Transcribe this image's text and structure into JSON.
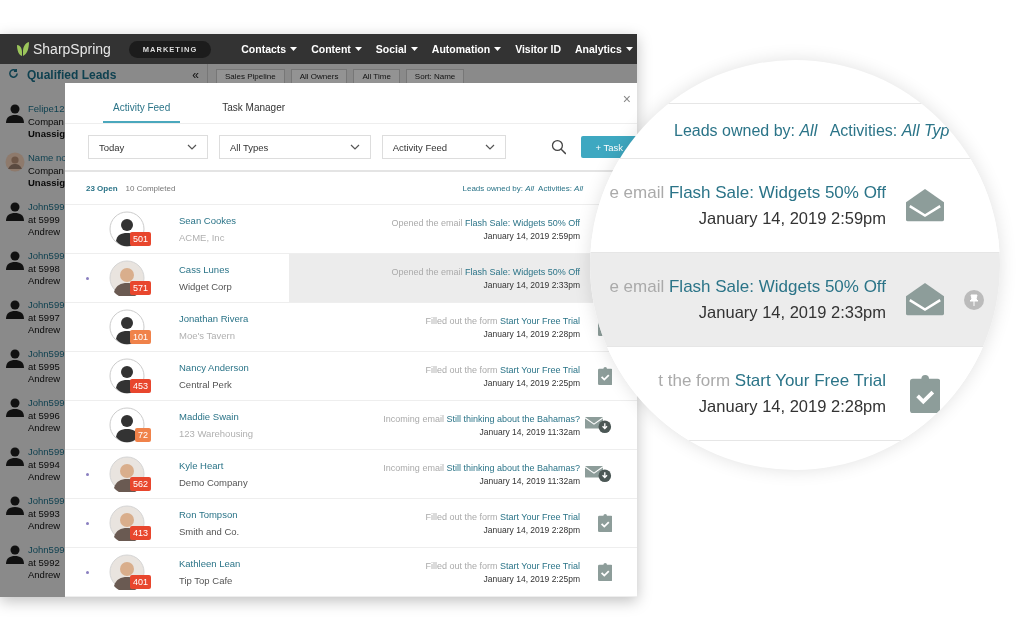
{
  "navbar": {
    "brand": "SharpSpring",
    "product": "MARKETING",
    "items": [
      {
        "label": "Contacts",
        "has_menu": true
      },
      {
        "label": "Content",
        "has_menu": true
      },
      {
        "label": "Social",
        "has_menu": true
      },
      {
        "label": "Automation",
        "has_menu": true
      },
      {
        "label": "Visitor ID",
        "has_menu": false
      },
      {
        "label": "Analytics",
        "has_menu": true
      }
    ]
  },
  "background": {
    "panel_title": "Qualified Leads",
    "collapse": "«",
    "filters": [
      "Sales Pipeline",
      "All Owners",
      "All Time",
      "Sort: Name"
    ],
    "leads": [
      {
        "name": "Felipe12",
        "line2": "Compan",
        "line3": "Unassig",
        "avatar": {
          "kind": "silhouette"
        }
      },
      {
        "name": "Name no",
        "line2": "Compan",
        "line3": "Unassig"
      },
      {
        "name": "John599",
        "line2": "at 5999",
        "line3": "Andrew",
        "avatar": {
          "kind": "silhouette"
        }
      },
      {
        "name": "John599",
        "line2": "at 5998",
        "line3": "Andrew",
        "avatar": {
          "kind": "silhouette"
        }
      },
      {
        "name": "John599",
        "line2": "at 5997",
        "line3": "Andrew",
        "avatar": {
          "kind": "silhouette"
        }
      },
      {
        "name": "John599",
        "line2": "at 5995",
        "line3": "Andrew",
        "avatar": {
          "kind": "silhouette"
        }
      },
      {
        "name": "John599",
        "line2": "at 5996",
        "line3": "Andrew",
        "avatar": {
          "kind": "silhouette"
        }
      },
      {
        "name": "John599",
        "line2": "at 5994",
        "line3": "Andrew",
        "avatar": {
          "kind": "silhouette"
        }
      },
      {
        "name": "John599",
        "line2": "at 5993",
        "line3": "Andrew",
        "avatar": {
          "kind": "silhouette"
        }
      },
      {
        "name": "John599",
        "line2": "at 5992",
        "line3": "Andrew",
        "avatar": {
          "kind": "silhouette"
        }
      }
    ]
  },
  "modal": {
    "tabs": [
      {
        "label": "Activity Feed",
        "selected": true
      },
      {
        "label": "Task Manager",
        "selected": false
      }
    ],
    "close": "×",
    "filters": [
      "Today",
      "All Types",
      "Activity Feed"
    ],
    "add_button": "+ Task",
    "open_count": "23 Open",
    "completed_count": "10 Completed",
    "owner_filter": "Leads owned by: *All*  Activities: *All*",
    "rows": [
      {
        "name": "Sean Cookes",
        "company": "ACME, Inc",
        "company_muted": true,
        "avatar": {
          "kind": "silhouette"
        },
        "score": "501",
        "color": "#e8462d",
        "unread": false,
        "highlighted": false,
        "action": "Opened the email",
        "subject": "Flash Sale: Widgets 50% Off",
        "date": "January 14, 2019 2:59pm"
      },
      {
        "name": "Cass Lunes",
        "company": "Widget Corp",
        "company_muted": false,
        "score": "571",
        "color": "#e8462d",
        "unread": true,
        "highlighted": true,
        "action": "Opened the email",
        "subject": "Flash Sale: Widgets 50% Off",
        "date": "January 14, 2019 2:33pm"
      },
      {
        "name": "Jonathan Rivera",
        "company": "Moe's Tavern",
        "company_muted": true,
        "avatar": {
          "kind": "silhouette"
        },
        "score": "101",
        "color": "#f0824a",
        "unread": false,
        "highlighted": false,
        "action": "Filled out the form",
        "subject": "Start Your Free Trial",
        "date": "January 14, 2019 2:28pm",
        "kind": "form"
      },
      {
        "name": "Nancy Anderson",
        "company": "Central Perk",
        "company_muted": false,
        "avatar": {
          "kind": "silhouette"
        },
        "score": "453",
        "color": "#e8462d",
        "unread": false,
        "highlighted": false,
        "action": "Filled out the form",
        "subject": "Start Your Free Trial",
        "date": "January 14, 2019 2:25pm",
        "kind": "form"
      },
      {
        "name": "Maddie Swain",
        "company": "123 Warehousing",
        "company_muted": true,
        "avatar": {
          "kind": "silhouette"
        },
        "score": "72",
        "color": "#f0824a",
        "unread": false,
        "highlighted": false,
        "action": "Incoming email",
        "subject": "Still thinking about the Bahamas?",
        "date": "January 14, 2019 11:32am",
        "kind": "email-in"
      },
      {
        "name": "Kyle Heart",
        "company": "Demo Company",
        "company_muted": false,
        "score": "562",
        "color": "#e8462d",
        "unread": true,
        "highlighted": false,
        "action": "Incoming email",
        "subject": "Still thinking about the Bahamas?",
        "date": "January 14, 2019 11:32am",
        "kind": "email-in"
      },
      {
        "name": "Ron Tompson",
        "company": "Smith and Co.",
        "company_muted": false,
        "score": "413",
        "color": "#e8462d",
        "unread": true,
        "highlighted": false,
        "action": "Filled out the form",
        "subject": "Start Your Free Trial",
        "date": "January 14, 2019 2:28pm",
        "kind": "form"
      },
      {
        "name": "Kathleen Lean",
        "company": "Tip Top Cafe",
        "company_muted": false,
        "score": "401",
        "color": "#e8462d",
        "unread": true,
        "highlighted": false,
        "action": "Filled out the form",
        "subject": "Start Your Free Trial",
        "date": "January 14, 2019 2:25pm",
        "kind": "form"
      }
    ]
  },
  "magnifier": {
    "owner_filter": "Leads owned by: *All*   Activities: *All Typ*",
    "rows": [
      {
        "action": "e email",
        "subject": "Flash Sale: Widgets 50% Off",
        "date": "January 14, 2019 2:59pm",
        "kind": "email-open",
        "highlighted": false,
        "pinned": false
      },
      {
        "action": "e email",
        "subject": "Flash Sale: Widgets 50% Off",
        "date": "January 14, 2019 2:33pm",
        "kind": "email-open",
        "highlighted": true,
        "pinned": true
      },
      {
        "action": "t the form",
        "subject": "Start Your Free Trial",
        "date": "January 14, 2019 2:28pm",
        "kind": "form",
        "highlighted": false,
        "pinned": false
      }
    ]
  }
}
